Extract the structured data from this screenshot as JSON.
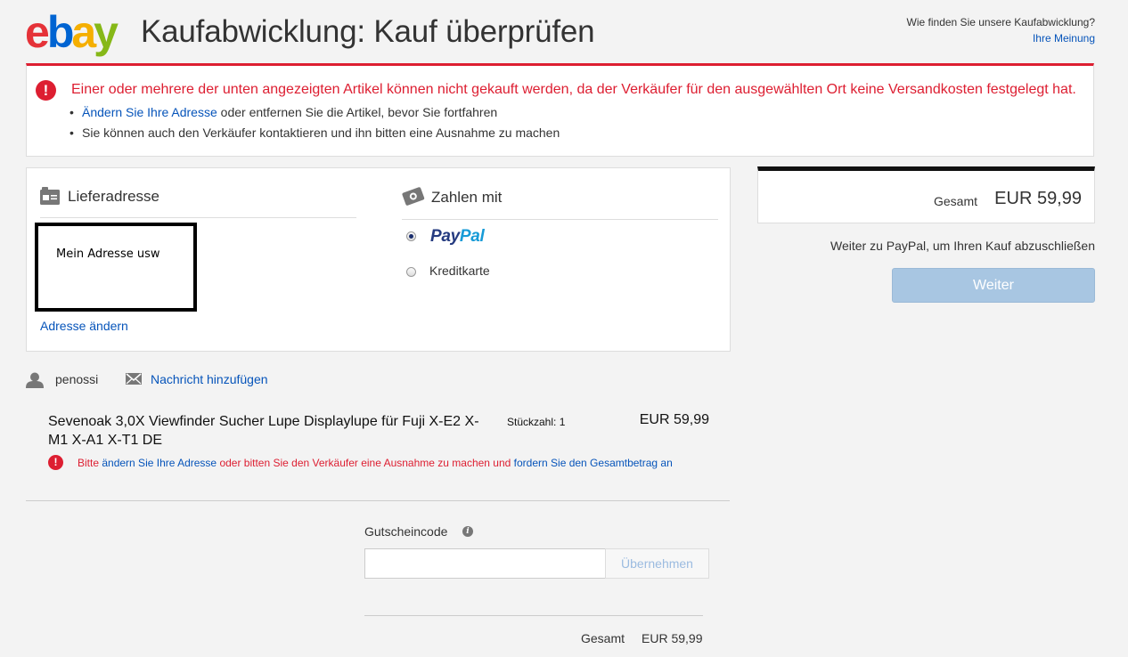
{
  "header": {
    "logo_text": "ebay",
    "title": "Kaufabwicklung: Kauf überprüfen",
    "feedback_question": "Wie finden Sie unsere Kaufabwicklung?",
    "feedback_link": "Ihre Meinung"
  },
  "banner": {
    "message": "Einer oder mehrere der unten angezeigten Artikel können nicht gekauft werden, da der Verkäufer für den ausgewählten Ort keine Versandkosten festgelegt hat.",
    "bullet1_link": "Ändern Sie Ihre Adresse",
    "bullet1_rest": " oder entfernen Sie die Artikel, bevor Sie fortfahren",
    "bullet2": "Sie können auch den Verkäufer kontaktieren und ihn bitten eine Ausnahme zu machen"
  },
  "shipping": {
    "title": "Lieferadresse",
    "address": "Mein Adresse usw",
    "change_link": "Adresse ändern"
  },
  "payment": {
    "title": "Zahlen mit",
    "options": [
      {
        "label_a": "Pay",
        "label_b": "Pal",
        "selected": true
      },
      {
        "label": "Kreditkarte",
        "selected": false
      }
    ]
  },
  "summary": {
    "total_label": "Gesamt",
    "total_value": "EUR 59,99",
    "note": "Weiter zu PayPal, um Ihren Kauf abzuschließen",
    "continue_button": "Weiter"
  },
  "seller": {
    "name": "penossi",
    "message_link": "Nachricht hinzufügen"
  },
  "item": {
    "title": "Sevenoak 3,0X Viewfinder Sucher Lupe Displaylupe für Fuji X-E2 X-M1 X-A1 X-T1 DE",
    "quantity": "Stückzahl: 1",
    "price": "EUR 59,99",
    "error_part1": "Bitte ",
    "error_link1": "ändern Sie Ihre Adresse",
    "error_part2": " oder bitten Sie den Verkäufer eine Ausnahme zu machen und ",
    "error_link2": "fordern Sie den Gesamtbetrag an"
  },
  "coupon": {
    "label": "Gutscheincode",
    "input_value": "",
    "button": "Übernehmen"
  },
  "footer_total": {
    "label": "Gesamt",
    "value": "EUR 59,99"
  },
  "colors": {
    "error_red": "#dd1e31",
    "link_blue": "#0654ba",
    "button_disabled_blue": "#a8c6e2"
  }
}
